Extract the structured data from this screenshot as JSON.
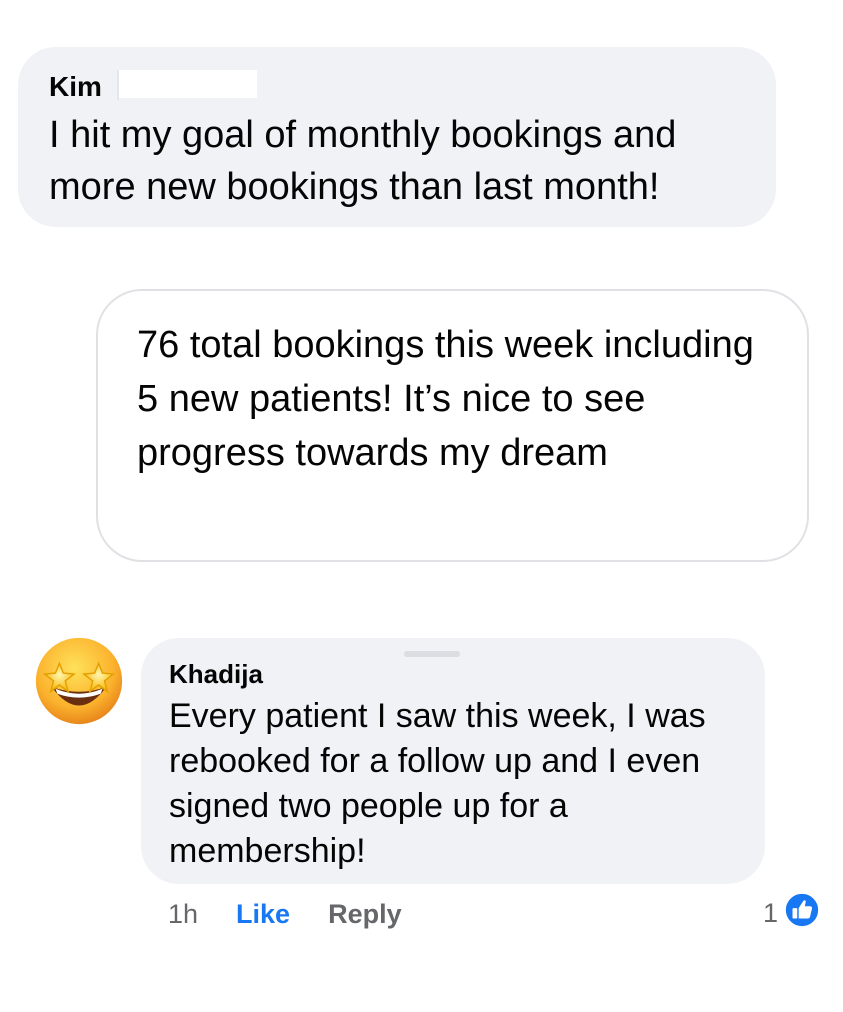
{
  "comment_kim": {
    "author": "Kim",
    "text": "I hit my goal of monthly bookings and more new bookings than last month!"
  },
  "quote_card": {
    "text": "76 total bookings this week including 5 new patients! It’s nice to see progress towards my dream"
  },
  "comment_khadija": {
    "author": "Khadija",
    "text": "Every patient I saw this week, I was rebooked for a follow up and I even signed two people up for a membership!",
    "avatar_icon": "star-struck-emoji-icon",
    "time": "1h",
    "like_label": "Like",
    "reply_label": "Reply",
    "reaction_count": "1",
    "reaction_icon": "thumbs-up-icon"
  },
  "colors": {
    "bubble_bg": "#f0f2f5",
    "link_blue": "#1877f2",
    "meta_gray": "#65676b"
  }
}
